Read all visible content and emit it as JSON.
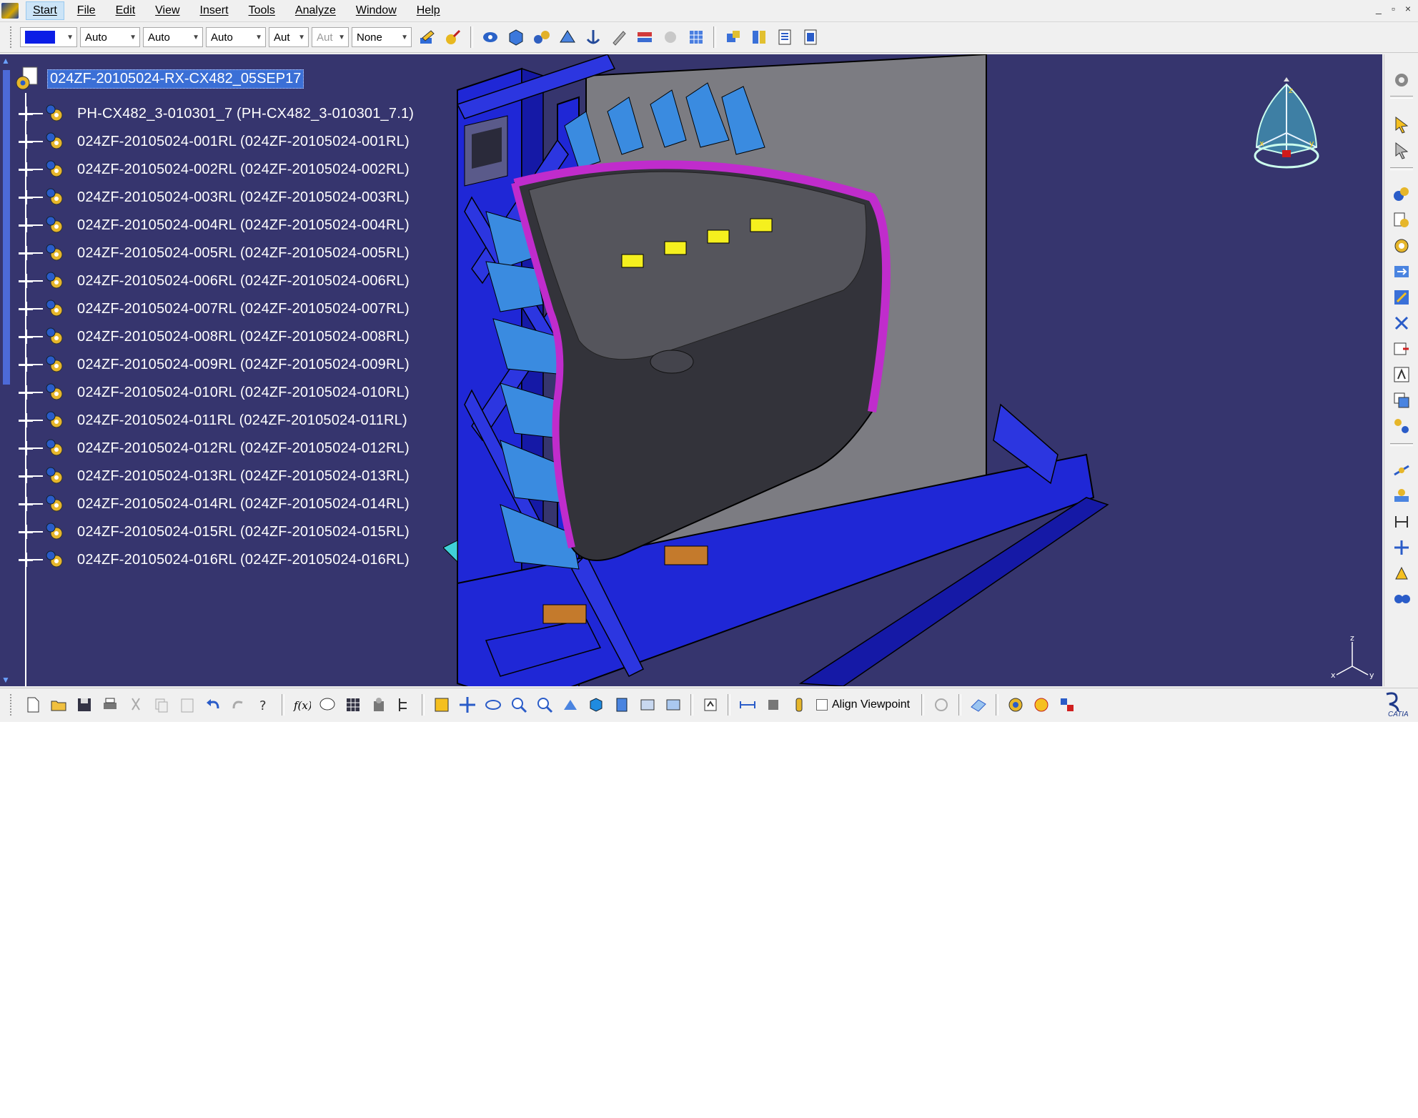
{
  "menu": {
    "items": [
      {
        "label": "Start",
        "active": true
      },
      {
        "label": "File"
      },
      {
        "label": "Edit"
      },
      {
        "label": "View"
      },
      {
        "label": "Insert"
      },
      {
        "label": "Tools"
      },
      {
        "label": "Analyze"
      },
      {
        "label": "Window"
      },
      {
        "label": "Help"
      }
    ],
    "window_controls": [
      "_",
      "▫",
      "×"
    ]
  },
  "toolbar": {
    "color_swatch": "#0c1ee6",
    "combos": [
      {
        "value": "Auto"
      },
      {
        "value": "Auto"
      },
      {
        "value": "Auto"
      },
      {
        "value": "Aut"
      },
      {
        "value": "Aut",
        "disabled": true
      },
      {
        "value": "None"
      }
    ]
  },
  "tree": {
    "root_label": "024ZF-20105024-RX-CX482_05SEP17",
    "items": [
      "PH-CX482_3-010301_7 (PH-CX482_3-010301_7.1)",
      "024ZF-20105024-001RL (024ZF-20105024-001RL)",
      "024ZF-20105024-002RL (024ZF-20105024-002RL)",
      "024ZF-20105024-003RL (024ZF-20105024-003RL)",
      "024ZF-20105024-004RL (024ZF-20105024-004RL)",
      "024ZF-20105024-005RL (024ZF-20105024-005RL)",
      "024ZF-20105024-006RL (024ZF-20105024-006RL)",
      "024ZF-20105024-007RL (024ZF-20105024-007RL)",
      "024ZF-20105024-008RL (024ZF-20105024-008RL)",
      "024ZF-20105024-009RL (024ZF-20105024-009RL)",
      "024ZF-20105024-010RL (024ZF-20105024-010RL)",
      "024ZF-20105024-011RL (024ZF-20105024-011RL)",
      "024ZF-20105024-012RL (024ZF-20105024-012RL)",
      "024ZF-20105024-013RL (024ZF-20105024-013RL)",
      "024ZF-20105024-014RL (024ZF-20105024-014RL)",
      "024ZF-20105024-015RL (024ZF-20105024-015RL)",
      "024ZF-20105024-016RL (024ZF-20105024-016RL)"
    ]
  },
  "viewport": {
    "background": "#36356e",
    "compass_labels": {
      "x": "x",
      "y": "y",
      "z": "z"
    },
    "axis_labels": {
      "x": "x",
      "y": "y",
      "z": "z"
    }
  },
  "bottom_toolbar": {
    "align_viewpoint_label": "Align Viewpoint",
    "brand_label": "CATIA"
  },
  "colors": {
    "frame_blue": "#1f27d6",
    "door_dark": "#33333a",
    "trim_magenta": "#c02ccc",
    "bracket_blue": "#3a8be0",
    "clamp_yellow": "#f5f01e",
    "panel_grey": "#7c7c82"
  }
}
